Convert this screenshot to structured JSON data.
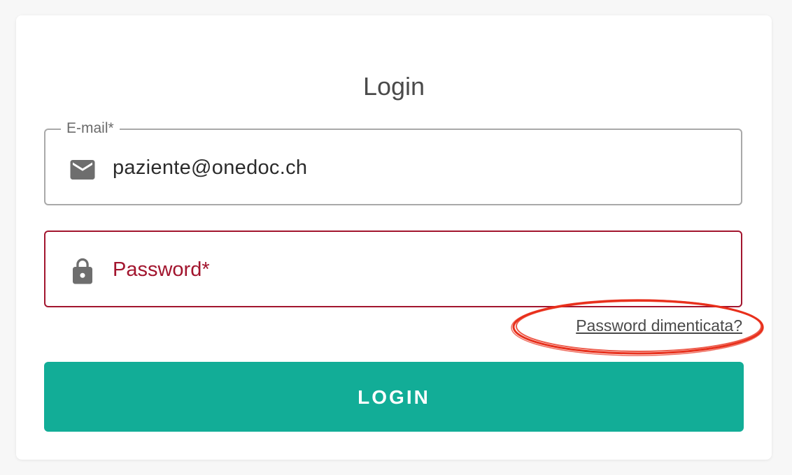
{
  "form": {
    "title": "Login",
    "email": {
      "label": "E-mail*",
      "value": "paziente@onedoc.ch",
      "icon": "mail-icon"
    },
    "password": {
      "placeholder": "Password*",
      "value": "",
      "icon": "lock-icon",
      "state": "error"
    },
    "forgot_link": "Password dimenticata?",
    "submit_label": "LOGIN"
  },
  "colors": {
    "accent": "#12ad97",
    "error": "#a2152e",
    "annotation": "#e8301c"
  }
}
